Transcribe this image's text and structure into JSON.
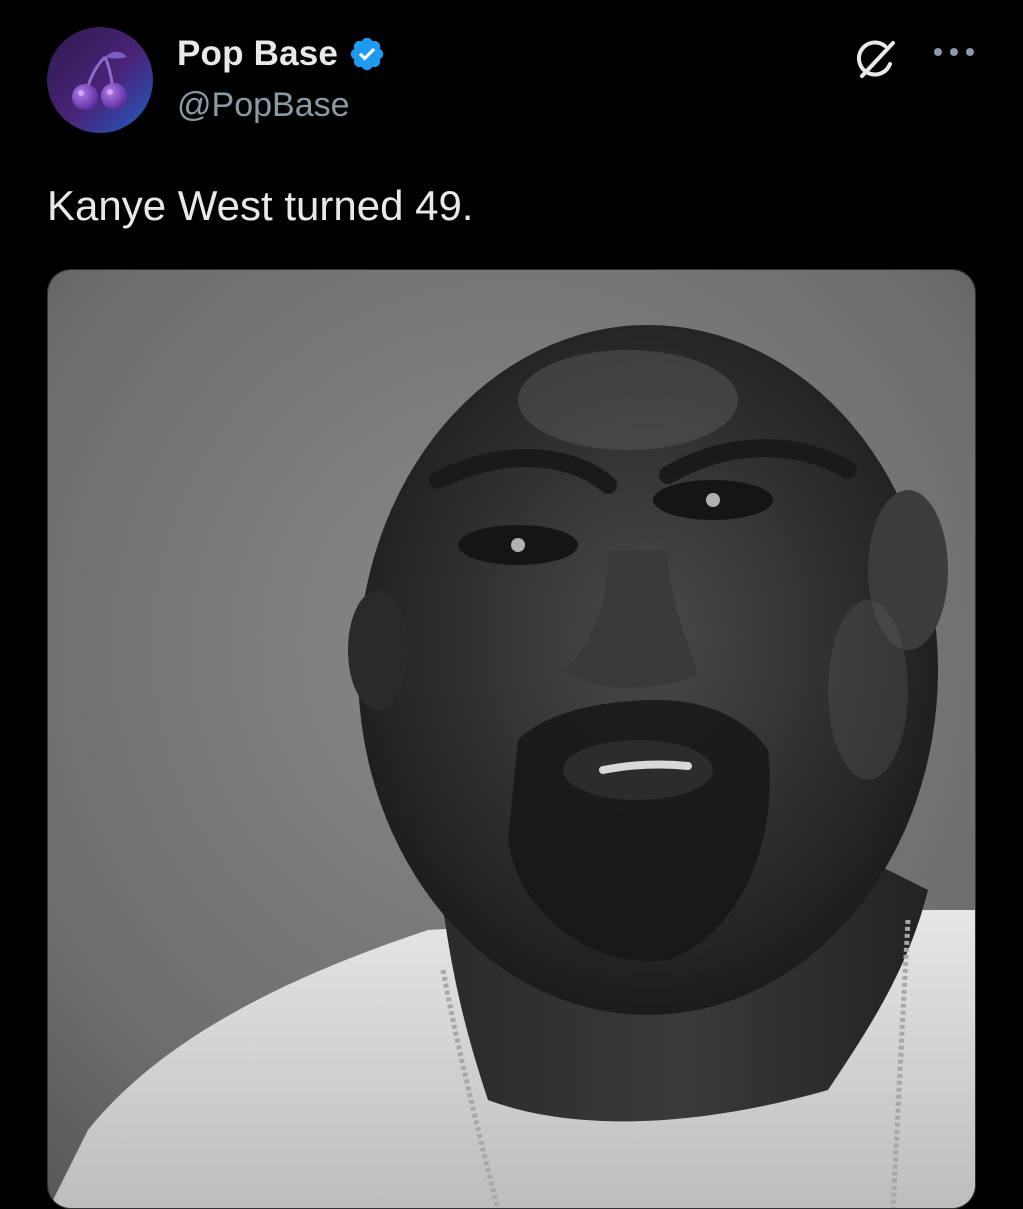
{
  "account": {
    "display_name": "Pop Base",
    "handle": "@PopBase",
    "verified": true,
    "verified_color": "#1d9bf0",
    "avatar_icon": "cherries-icon",
    "avatar_colors": [
      "#2b1b4d",
      "#5a2a8a",
      "#1f5fc4"
    ]
  },
  "post": {
    "text": "Kanye West turned 49.",
    "media": {
      "type": "photo",
      "style": "black-and-white portrait"
    }
  },
  "actions": {
    "grok_icon": "grok-icon",
    "more_icon": "more-options-icon"
  },
  "theme": {
    "background": "#000000",
    "text_primary": "#e7e9ea",
    "text_secondary": "#8b98a5"
  }
}
